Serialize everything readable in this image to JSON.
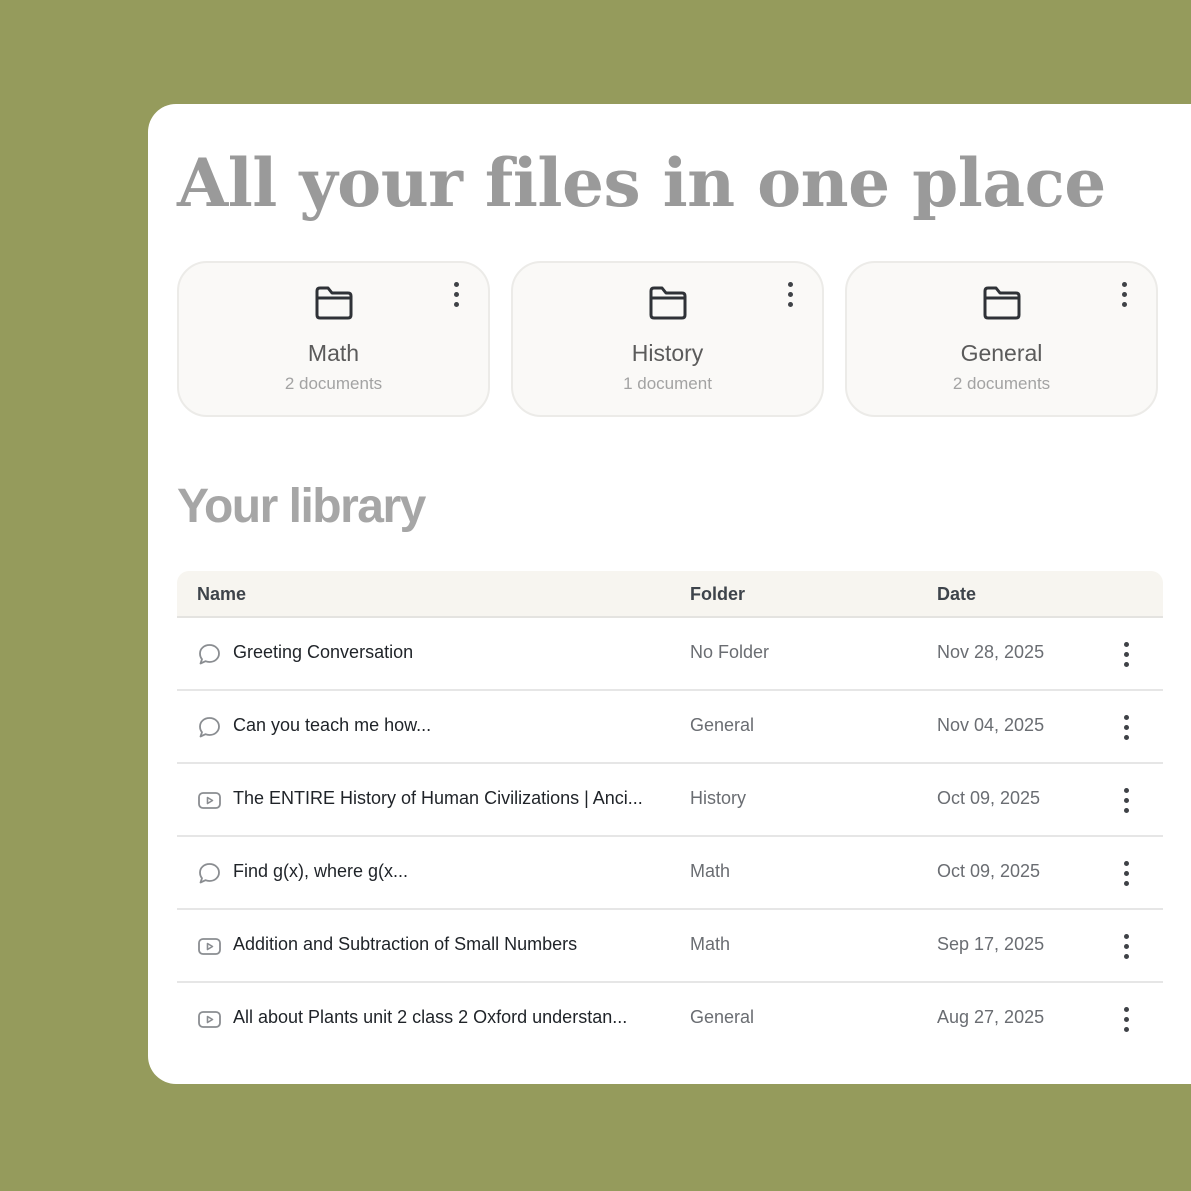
{
  "headline": "All your files in one place",
  "folders": [
    {
      "name": "Math",
      "count": "2 documents"
    },
    {
      "name": "History",
      "count": "1 document"
    },
    {
      "name": "General",
      "count": "2 documents"
    }
  ],
  "library": {
    "title": "Your library",
    "columns": {
      "name": "Name",
      "folder": "Folder",
      "date": "Date"
    },
    "rows": [
      {
        "icon": "chat-bubble-icon",
        "name": "Greeting Conversation",
        "folder": "No Folder",
        "date": "Nov 28, 2025"
      },
      {
        "icon": "chat-bubble-icon",
        "name": "Can you teach me how...",
        "folder": "General",
        "date": "Nov 04, 2025"
      },
      {
        "icon": "video-play-icon",
        "name": "The ENTIRE History of Human Civilizations | Anci...",
        "folder": "History",
        "date": "Oct 09, 2025"
      },
      {
        "icon": "chat-bubble-icon",
        "name": "Find g(x), where g(x...",
        "folder": "Math",
        "date": "Oct 09, 2025"
      },
      {
        "icon": "video-play-icon",
        "name": "Addition and Subtraction of Small Numbers",
        "folder": "Math",
        "date": "Sep 17, 2025"
      },
      {
        "icon": "video-play-icon",
        "name": "All about Plants unit 2 class 2 Oxford understan...",
        "folder": "General",
        "date": "Aug 27, 2025"
      }
    ]
  },
  "colors": {
    "background": "#959b5c",
    "panel": "#ffffff",
    "card": "#faf9f7",
    "header_row": "#f7f5f0"
  }
}
